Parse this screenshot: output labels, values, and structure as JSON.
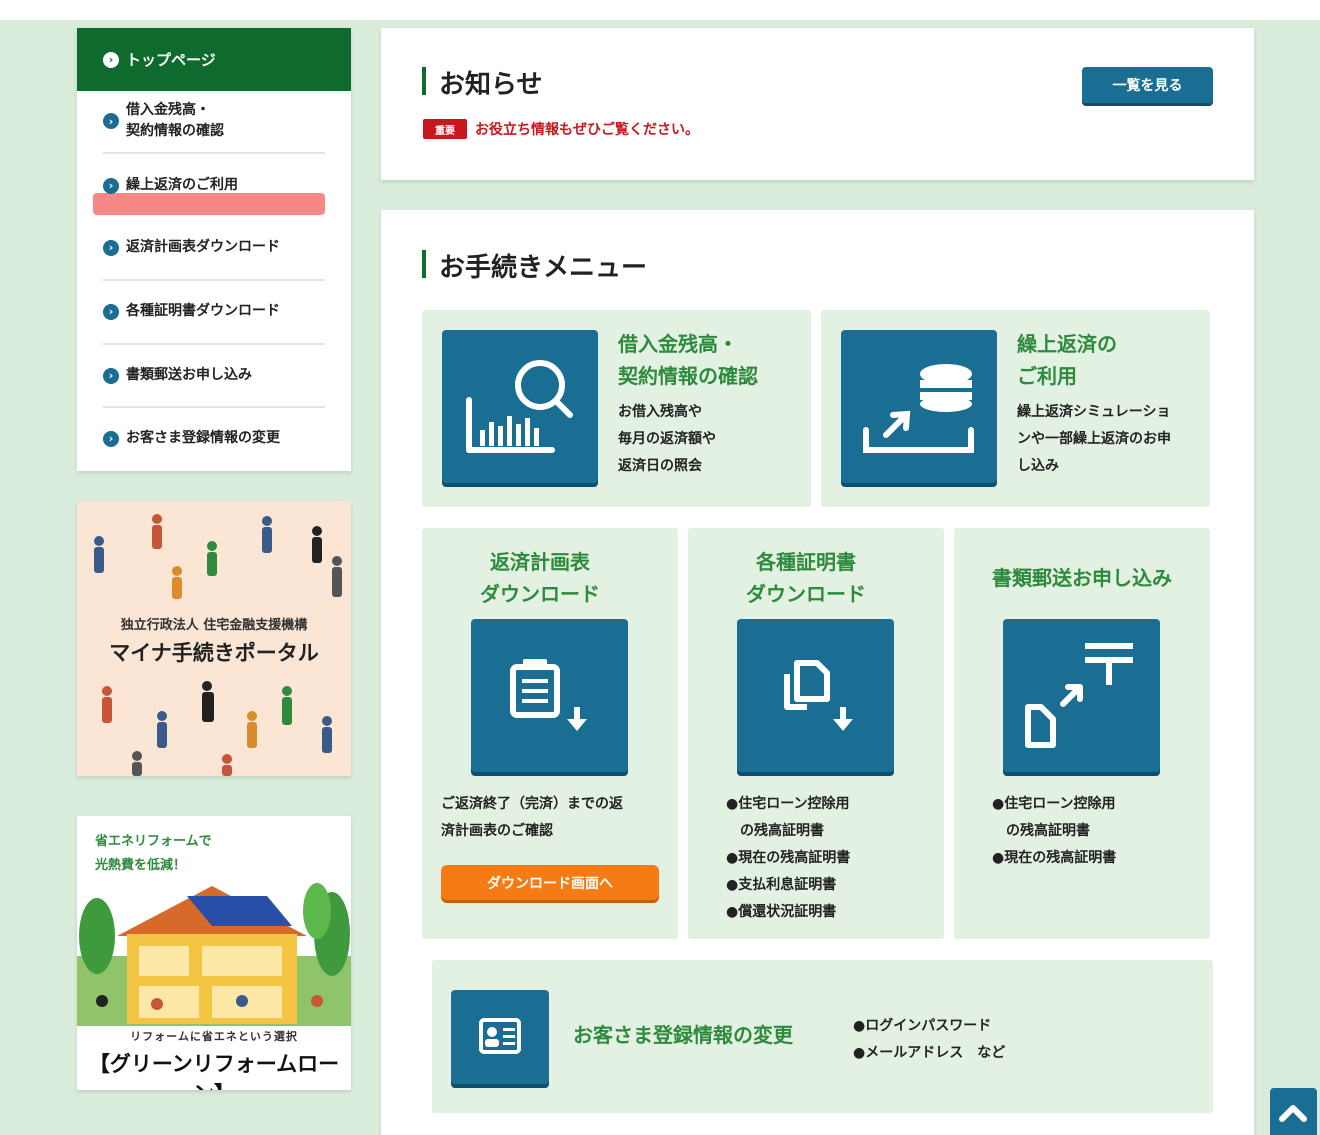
{
  "sidebar": {
    "top_label": "トップページ",
    "items": [
      {
        "label_line1": "借入金残高・",
        "label_line2": "契約情報の確認"
      },
      {
        "label": "繰上返済のご利用"
      },
      {
        "label": "返済計画表ダウンロード"
      },
      {
        "label": "各種証明書ダウンロード"
      },
      {
        "label": "書類郵送お申し込み"
      },
      {
        "label": "お客さま登録情報の変更"
      }
    ]
  },
  "banner_portal": {
    "org": "独立行政法人 住宅金融支援機構",
    "title": "マイナ手続きポータル"
  },
  "banner_reform": {
    "line1": "省エネリフォームで",
    "line2": "光熱費を低減！",
    "sub": "リフォームに省エネという選択",
    "title": "【グリーンリフォームローン】"
  },
  "notice": {
    "title": "お知らせ",
    "list_button": "一覧を見る",
    "badge": "重要",
    "text": "お役立ち情報もぜひご覧ください。"
  },
  "menu": {
    "title": "お手続きメニュー",
    "balance": {
      "title1": "借入金残高・",
      "title2": "契約情報の確認",
      "desc1": "お借入残高や",
      "desc2": "毎月の返済額や",
      "desc3": "返済日の照会"
    },
    "prepay": {
      "title1": "繰上返済の",
      "title2": "ご利用",
      "desc1": "繰上返済シミュレーショ",
      "desc2": "ンや一部繰上返済のお申",
      "desc3": "し込み"
    },
    "schedule": {
      "title1": "返済計画表",
      "title2": "ダウンロード",
      "desc1": "ご返済終了（完済）までの返",
      "desc2": "済計画表のご確認",
      "button": "ダウンロード画面へ"
    },
    "certs": {
      "title1": "各種証明書",
      "title2": "ダウンロード",
      "items": [
        "●住宅ローン控除用",
        "　の残高証明書",
        "●現在の残高証明書",
        "●支払利息証明書",
        "●償還状況証明書"
      ]
    },
    "mail": {
      "title": "書類郵送お申し込み",
      "items": [
        "●住宅ローン控除用",
        "　の残高証明書",
        "●現在の残高証明書"
      ]
    },
    "customer": {
      "title": "お客さま登録情報の変更",
      "items": [
        "●ログインパスワード",
        "●メールアドレス　など"
      ]
    }
  },
  "colors": {
    "brand_green": "#0e6b2d",
    "accent_blue": "#1a6e94",
    "important_red": "#c8171d",
    "download_orange": "#f57c14",
    "tile_bg": "#e3f1e3"
  }
}
